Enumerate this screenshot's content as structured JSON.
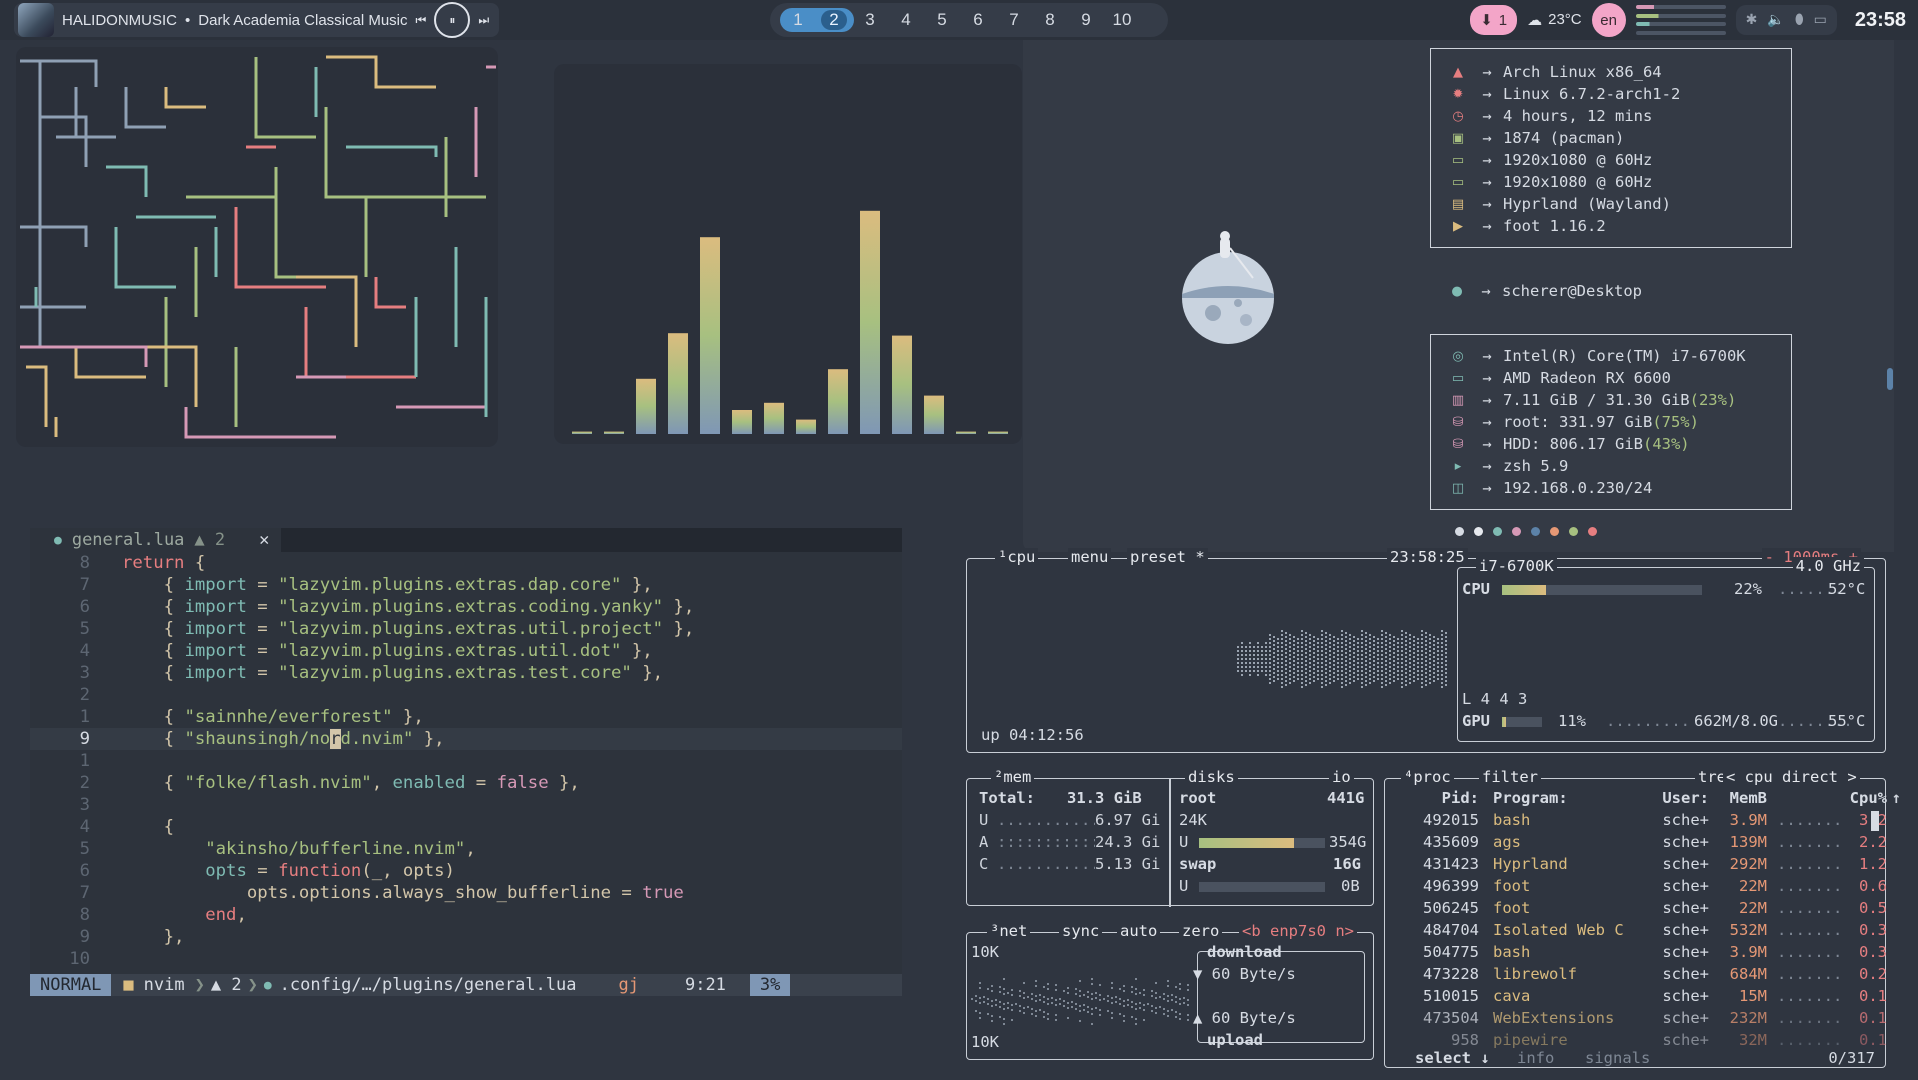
{
  "topbar": {
    "media": {
      "artist": "HALIDONMUSIC",
      "separator": "•",
      "title": "Dark Academia Classical Music",
      "prev": "⏮",
      "pause": "⏸",
      "next": "⏭"
    },
    "workspaces": [
      "1",
      "2",
      "3",
      "4",
      "5",
      "6",
      "7",
      "8",
      "9",
      "10"
    ],
    "active_workspace": "2",
    "updates": {
      "icon": "⬇",
      "count": "1"
    },
    "weather": {
      "icon": "☁",
      "temp": "23°C"
    },
    "language": "en",
    "sys_icons": [
      "✱",
      "🔈",
      "⬮",
      "▭"
    ],
    "clock": "23:58"
  },
  "fastfetch": {
    "group1": [
      {
        "icon": "arch-icon",
        "glyph": "▲",
        "color": "#e67e80",
        "text": "Arch Linux x86_64"
      },
      {
        "icon": "gear-icon",
        "glyph": "✹",
        "color": "#e67e80",
        "text": "Linux 6.7.2-arch1-2"
      },
      {
        "icon": "clock-icon",
        "glyph": "◷",
        "color": "#e67e80",
        "text": "4 hours, 12 mins"
      },
      {
        "icon": "package-icon",
        "glyph": "▣",
        "color": "#a7c080",
        "text": "1874 (pacman)"
      },
      {
        "icon": "monitor-icon",
        "glyph": "▭",
        "color": "#a7c080",
        "text": "1920x1080 @ 60Hz"
      },
      {
        "icon": "monitor-icon",
        "glyph": "▭",
        "color": "#a7c080",
        "text": "1920x1080 @ 60Hz"
      },
      {
        "icon": "window-icon",
        "glyph": "▤",
        "color": "#dbbc7f",
        "text": "Hyprland (Wayland)"
      },
      {
        "icon": "terminal-icon",
        "glyph": "▶",
        "color": "#dbbc7f",
        "text": "foot 1.16.2"
      }
    ],
    "user": {
      "icon": "user-icon",
      "glyph": "●",
      "color": "#7fbbb3",
      "text": "scherer@Desktop"
    },
    "group2": [
      {
        "icon": "cpu-icon",
        "glyph": "◎",
        "color": "#7fbbb3",
        "text": "Intel(R) Core(TM) i7-6700K"
      },
      {
        "icon": "gpu-icon",
        "glyph": "▭",
        "color": "#7fbbb3",
        "text": "AMD Radeon RX 6600"
      },
      {
        "icon": "ram-icon",
        "glyph": "▥",
        "color": "#d699b6",
        "text": "7.11 GiB / 31.30 GiB ",
        "pct": "(23%)"
      },
      {
        "icon": "disk-icon",
        "glyph": "⛁",
        "color": "#d699b6",
        "text": "root: 331.97 GiB ",
        "pct": "(75%)"
      },
      {
        "icon": "disk-icon",
        "glyph": "⛁",
        "color": "#d699b6",
        "text": "HDD: 806.17 GiB ",
        "pct": "(43%)"
      },
      {
        "icon": "shell-icon",
        "glyph": "▸",
        "color": "#7fbbb3",
        "text": "zsh 5.9"
      },
      {
        "icon": "network-icon",
        "glyph": "◫",
        "color": "#7fbbb3",
        "text": "192.168.0.230/24"
      }
    ],
    "arrow": "→",
    "palette": [
      "#d6dbe3",
      "#e6e9ee",
      "#7fbbb3",
      "#d699b6",
      "#5c82a8",
      "#e69875",
      "#a7c080",
      "#e67e80"
    ]
  },
  "nvim": {
    "tab": {
      "name": "general.lua",
      "warn": "▲ 2",
      "close": "✕"
    },
    "lines": [
      {
        "n": "8",
        "html": "<span class='kw'>return</span> {"
      },
      {
        "n": "7",
        "html": "    { <span class='fn'>import</span> = <span class='str'>\"lazyvim.plugins.extras.dap.core\"</span> },"
      },
      {
        "n": "6",
        "html": "    { <span class='fn'>import</span> = <span class='str'>\"lazyvim.plugins.extras.coding.yanky\"</span> },"
      },
      {
        "n": "5",
        "html": "    { <span class='fn'>import</span> = <span class='str'>\"lazyvim.plugins.extras.util.project\"</span> },"
      },
      {
        "n": "4",
        "html": "    { <span class='fn'>import</span> = <span class='str'>\"lazyvim.plugins.extras.util.dot\"</span> },"
      },
      {
        "n": "3",
        "html": "    { <span class='fn'>import</span> = <span class='str'>\"lazyvim.plugins.extras.test.core\"</span> },"
      },
      {
        "n": "2",
        "html": ""
      },
      {
        "n": "1",
        "html": "    { <span class='str'>\"sainnhe/everforest\"</span> },"
      },
      {
        "n": "9",
        "html": "    { <span class='str'>\"shaunsingh/no<span style='background:#d3c6aa;color:#2d333c'>r</span>d.nvim\"</span> },",
        "cur": true
      },
      {
        "n": "1",
        "html": ""
      },
      {
        "n": "2",
        "html": "    { <span class='str'>\"folke/flash.nvim\"</span>, <span class='fn'>enabled</span> = <span class='bool'>false</span> },"
      },
      {
        "n": "3",
        "html": ""
      },
      {
        "n": "4",
        "html": "    {"
      },
      {
        "n": "5",
        "html": "        <span class='str'>\"akinsho/bufferline.nvim\"</span>,"
      },
      {
        "n": "6",
        "html": "        <span class='fn'>opts</span> = <span class='kw'>function</span>(_, opts)"
      },
      {
        "n": "7",
        "html": "            opts.options.always_show_bufferline = <span class='bool'>true</span>"
      },
      {
        "n": "8",
        "html": "        <span class='kw'>end</span>,"
      },
      {
        "n": "9",
        "html": "    },"
      },
      {
        "n": "10",
        "html": ""
      }
    ],
    "status": {
      "mode": "NORMAL",
      "branch": "nvim",
      "warn": "▲ 2",
      "path": ".config/…/plugins/general.lua",
      "keys": "gj",
      "pos": "9:21",
      "pct": "3%"
    }
  },
  "btop": {
    "cpu_box": {
      "tabs": [
        "¹cpu",
        "menu",
        "preset *"
      ],
      "time": "23:58:25",
      "interval": "- 1000ms +",
      "uptime": "up 04:12:56"
    },
    "cpu_info": {
      "model": "i7-6700K",
      "freq": "4.0 GHz",
      "cpu_label": "CPU",
      "cpu_pct": "22%",
      "cpu_temp": "52°C",
      "load": "L 4 4 3",
      "gpu_label": "GPU",
      "gpu_pct": "11%",
      "gpu_mem": "662M/8.0G",
      "gpu_temp": "55°C",
      "cpu_frac": 0.22,
      "gpu_frac": 0.11
    },
    "mem": {
      "title": "²mem",
      "total_label": "Total:",
      "total": "31.3 GiB",
      "rows": [
        {
          "k": "U",
          "v": "6.97 Gi"
        },
        {
          "k": "A",
          "v": "24.3 Gi"
        },
        {
          "k": "C",
          "v": "5.13 Gi"
        }
      ]
    },
    "disks": {
      "title": "disks",
      "io": "io",
      "root": "root",
      "root_size": "441G",
      "io_val": "24K",
      "root_used": "354G",
      "swap": "swap",
      "swap_size": "16G",
      "swap_used": "0B",
      "root_frac": 0.75,
      "swap_frac": 0.0
    },
    "net": {
      "title": "³net",
      "sync": "sync",
      "auto": "auto",
      "zero": "zero",
      "iface": "<b enp7s0 n>",
      "scale_top": "10K",
      "scale_bot": "10K",
      "download": "download",
      "down_rate": "▼ 60 Byte/s",
      "up_rate": "▲ 60 Byte/s",
      "upload": "upload"
    },
    "proc": {
      "title": "⁴proc",
      "filter": "filter",
      "tree": "tree",
      "mode": "< cpu direct >",
      "headers": {
        "pid": "Pid:",
        "program": "Program:",
        "user": "User:",
        "mem": "MemB",
        "cpu": "Cpu%",
        "sort": "↑"
      },
      "rows": [
        {
          "pid": "492015",
          "prog": "bash",
          "user": "sche+",
          "mem": "3.9M",
          "cpu": "3.2"
        },
        {
          "pid": "435609",
          "prog": "ags",
          "user": "sche+",
          "mem": "139M",
          "cpu": "2.2"
        },
        {
          "pid": "431423",
          "prog": "Hyprland",
          "user": "sche+",
          "mem": "292M",
          "cpu": "1.2"
        },
        {
          "pid": "496399",
          "prog": "foot",
          "user": "sche+",
          "mem": "22M",
          "cpu": "0.6"
        },
        {
          "pid": "506245",
          "prog": "foot",
          "user": "sche+",
          "mem": "22M",
          "cpu": "0.5"
        },
        {
          "pid": "484704",
          "prog": "Isolated Web C",
          "user": "sche+",
          "mem": "532M",
          "cpu": "0.3"
        },
        {
          "pid": "504775",
          "prog": "bash",
          "user": "sche+",
          "mem": "3.9M",
          "cpu": "0.3"
        },
        {
          "pid": "473228",
          "prog": "librewolf",
          "user": "sche+",
          "mem": "684M",
          "cpu": "0.2"
        },
        {
          "pid": "510015",
          "prog": "cava",
          "user": "sche+",
          "mem": "15M",
          "cpu": "0.1"
        },
        {
          "pid": "473504",
          "prog": "WebExtensions",
          "user": "sche+",
          "mem": "232M",
          "cpu": "0.1"
        },
        {
          "pid": "958",
          "prog": "pipewire",
          "user": "sche+",
          "mem": "32M",
          "cpu": "0.1"
        }
      ],
      "footer": {
        "select": "select ↓",
        "info": "info",
        "signals": "signals",
        "count": "0/317"
      }
    }
  },
  "visualizer": {
    "bars": [
      0.01,
      0.01,
      0.23,
      0.42,
      0.82,
      0.1,
      0.13,
      0.06,
      0.27,
      0.93,
      0.41,
      0.16,
      0.01,
      0.01
    ]
  }
}
